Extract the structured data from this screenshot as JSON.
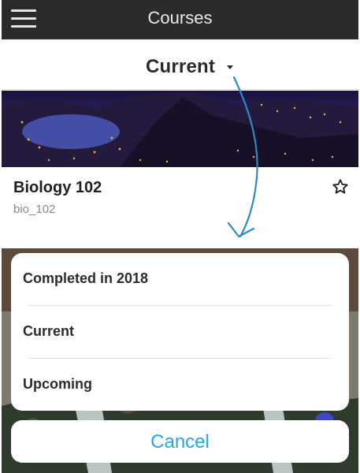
{
  "header": {
    "title": "Courses",
    "menu_icon": "hamburger-menu-icon"
  },
  "filter": {
    "selected": "Current",
    "caret_icon": "caret-down-icon"
  },
  "course": {
    "title": "Biology 102",
    "code": "bio_102",
    "favorite_icon": "star-outline-icon"
  },
  "sheet": {
    "options": [
      "Completed in 2018",
      "Current",
      "Upcoming"
    ],
    "cancel_label": "Cancel"
  },
  "colors": {
    "appbar": "#2b2b2b",
    "accent": "#2aa6df",
    "annotation_arrow": "#2e8bc0"
  }
}
